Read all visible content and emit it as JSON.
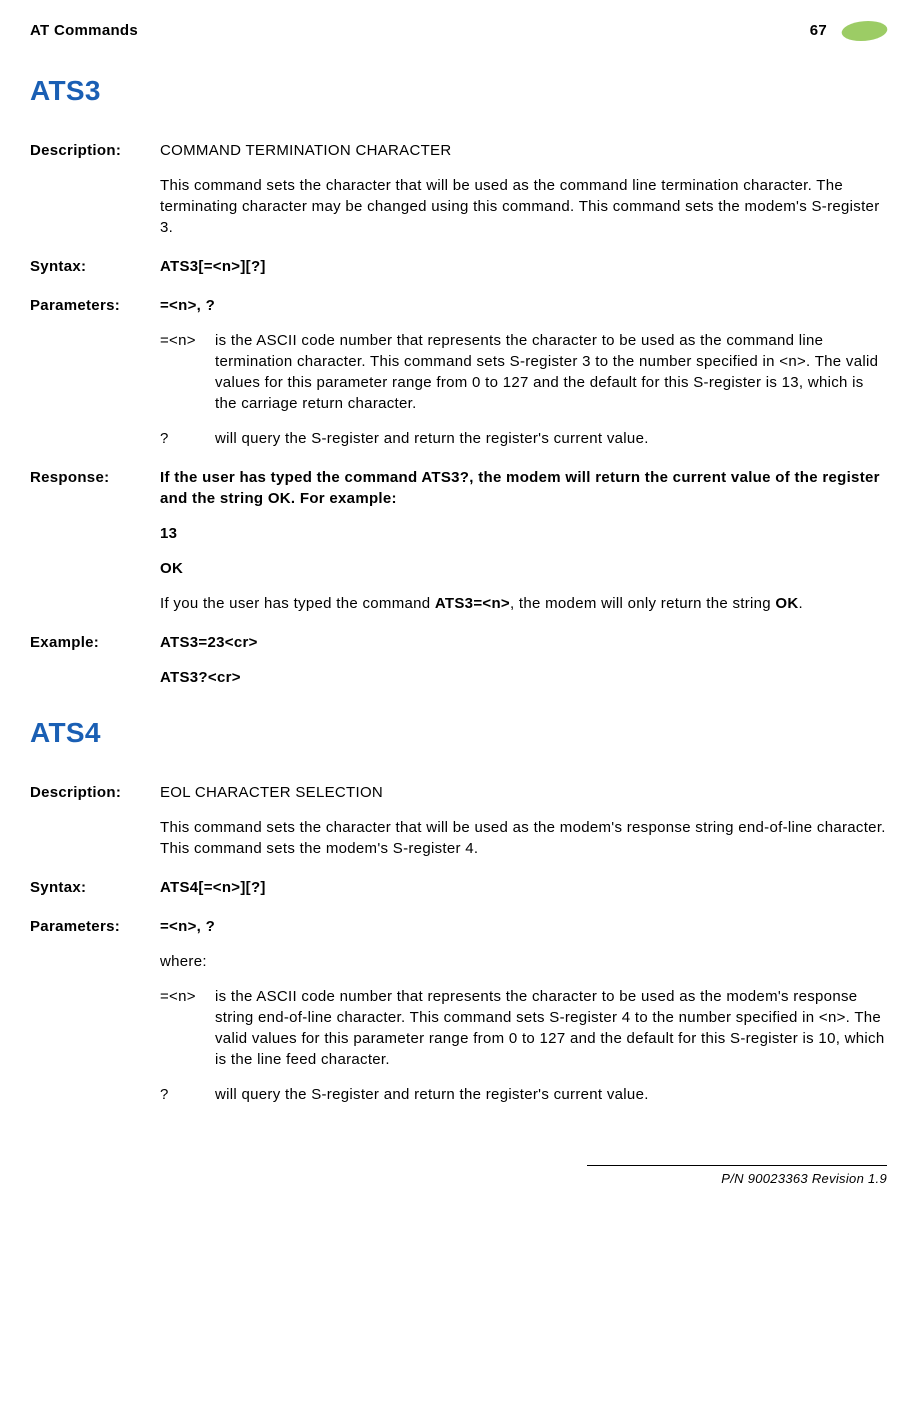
{
  "header": {
    "left": "AT Commands",
    "page": "67"
  },
  "sections": [
    {
      "title": "ATS3",
      "entries": [
        {
          "label": "Description:",
          "heading": "COMMAND TERMINATION CHARACTER",
          "paragraphs": [
            "This command sets the character that will be used as the command line termination character. The terminating character may be changed using this command. This command sets the modem's S-register 3."
          ]
        },
        {
          "label": "Syntax:",
          "bold_lines": [
            "ATS3[=<n>][?]"
          ]
        },
        {
          "label": "Parameters:",
          "bold_lines": [
            "=<n>, ?"
          ],
          "params": [
            {
              "k": "=<n>",
              "v": "is the ASCII code number that represents the character to be used as the command line termination character. This command sets S-register 3 to the number specified in <n>. The valid values for this parameter range from 0 to 127 and the default for this S-register is 13, which is the carriage return character."
            },
            {
              "k": "?",
              "v": "will query the S-register and return the register's current value."
            }
          ]
        },
        {
          "label": "Response:",
          "bold_paragraphs": [
            "If the user has typed the command ATS3?, the modem will return the current value of the register and the string OK. For example:",
            "13",
            "OK"
          ],
          "mixed_html": "If you the user has typed the command <b>ATS3=<n></b>, the modem will only return the string <b>OK</b>."
        },
        {
          "label": "Example:",
          "bold_lines": [
            "ATS3=23<cr>",
            "ATS3?<cr>"
          ]
        }
      ]
    },
    {
      "title": "ATS4",
      "entries": [
        {
          "label": "Description:",
          "heading": "EOL CHARACTER SELECTION",
          "paragraphs": [
            "This command sets the character that will be used as the modem's response string end-of-line character. This command sets the modem's S-register 4."
          ]
        },
        {
          "label": "Syntax:",
          "bold_lines": [
            "ATS4[=<n>][?]"
          ]
        },
        {
          "label": "Parameters:",
          "bold_lines": [
            "=<n>, ?"
          ],
          "where": "where:",
          "params": [
            {
              "k": "=<n>",
              "v": "is the ASCII code number that represents the character to be used as the modem's response string end-of-line character. This command sets S-register 4 to the number specified in <n>. The valid values for this parameter range from 0 to 127 and the default for this S-register is 10, which is the line feed character."
            },
            {
              "k": "?",
              "v": "will query the S-register and return the register's current value."
            }
          ]
        }
      ]
    }
  ],
  "footer": "P/N 90023363  Revision 1.9"
}
